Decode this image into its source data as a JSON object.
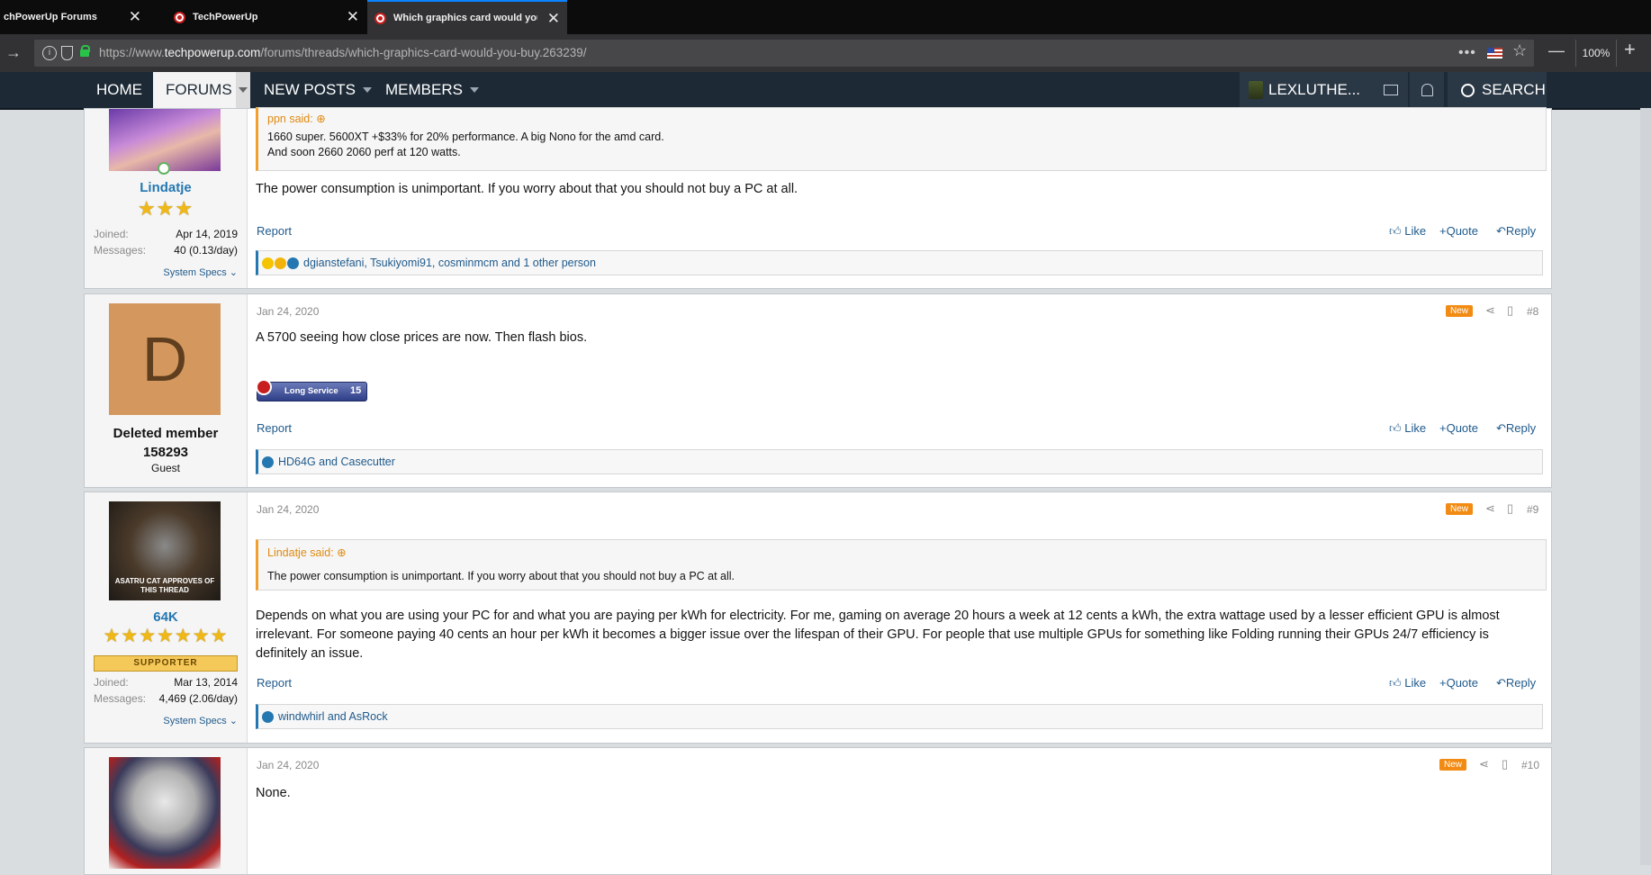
{
  "browser": {
    "tabs": [
      {
        "title": "chPowerUp Forums",
        "active": false
      },
      {
        "title": "TechPowerUp",
        "active": false
      },
      {
        "title": "Which graphics card would you",
        "active": true
      }
    ],
    "url_prefix": "https://www.",
    "url_domain": "techpowerup.com",
    "url_path": "/forums/threads/which-graphics-card-would-you-buy.263239/",
    "zoom": "100%",
    "icons": [
      "back-arrow-icon",
      "info-icon",
      "shield-icon",
      "lock-icon",
      "more-icon",
      "flag-icon",
      "bookmark-star-icon",
      "zoom-out-icon",
      "zoom-in-icon"
    ]
  },
  "nav": {
    "home": "HOME",
    "forums": "FORUMS",
    "new_posts": "NEW POSTS",
    "members": "MEMBERS",
    "user": "LEXLUTHE...",
    "search": "SEARCH",
    "colors": {
      "bar": "#1d2a36",
      "accent": "#f28b13",
      "link": "#1f5a8c"
    }
  },
  "posts": [
    {
      "username": "Lindatje",
      "stars": 3,
      "joined_label": "Joined:",
      "joined": "Apr 14, 2019",
      "messages_label": "Messages:",
      "messages": "40 (0.13/day)",
      "specs": "System Specs",
      "quote_attr": "ppn said:",
      "quote_lines": [
        "1660 super. 5600XT +$33% for 20% performance. A big Nono for the amd card.",
        "And soon 2660 2060 perf at 120 watts."
      ],
      "text": "The power consumption is unimportant. If you worry about that you should not buy a PC at all.",
      "report": "Report",
      "like": "Like",
      "quote": "Quote",
      "reply": "Reply",
      "reactions": "dgianstefani, Tsukiyomi91, cosminmcm and 1 other person"
    },
    {
      "avatar_letter": "D",
      "username": "Deleted member",
      "username2": "158293",
      "role": "Guest",
      "date": "Jan 24, 2020",
      "new": "New",
      "number": "#8",
      "text": "A 5700 seeing how close prices are now. Then flash bios.",
      "badge": "Long Service",
      "badge_years": "15",
      "report": "Report",
      "like": "Like",
      "quote": "Quote",
      "reply": "Reply",
      "reactions": "HD64G and Casecutter"
    },
    {
      "avatar_caption": "ASATRU CAT APPROVES OF THIS THREAD",
      "username": "64K",
      "stars": 7,
      "supporter": "SUPPORTER",
      "joined_label": "Joined:",
      "joined": "Mar 13, 2014",
      "messages_label": "Messages:",
      "messages": "4,469 (2.06/day)",
      "specs": "System Specs",
      "date": "Jan 24, 2020",
      "new": "New",
      "number": "#9",
      "quote_attr": "Lindatje said:",
      "quote_lines": [
        "The power consumption is unimportant. If you worry about that you should not buy a PC at all."
      ],
      "text": "Depends on what you are using your PC for and what you are paying per kWh for electricity. For me, gaming on average 20 hours a week at 12 cents a kWh, the extra wattage used by a lesser efficient GPU is almost irrelevant. For someone paying 40 cents an hour per kWh it becomes a bigger issue over the lifespan of their GPU. For people that use multiple GPUs for something like Folding running their GPUs 24/7 efficiency is definitely an issue.",
      "report": "Report",
      "like": "Like",
      "quote": "Quote",
      "reply": "Reply",
      "reactions": "windwhirl and AsRock"
    },
    {
      "date": "Jan 24, 2020",
      "new": "New",
      "number": "#10",
      "text": "None."
    }
  ]
}
